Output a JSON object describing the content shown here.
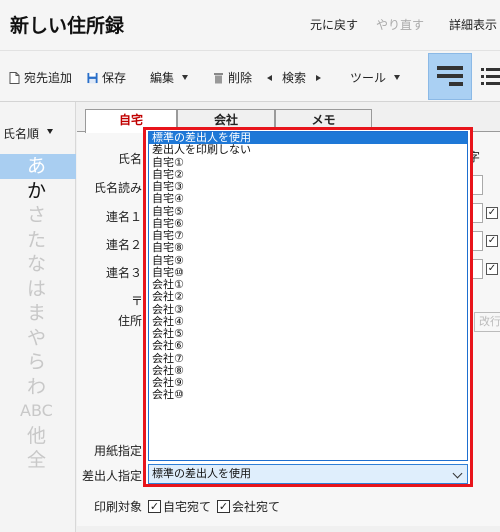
{
  "window": {
    "title": "新しい住所録",
    "undo_label": "元に戻す",
    "redo_label": "やり直す",
    "detail_view_label": "詳細表示"
  },
  "toolbar": {
    "add_label": "宛先追加",
    "save_label": "保存",
    "edit_label": "編集",
    "delete_label": "削除",
    "search_label": "検索",
    "tools_label": "ツール"
  },
  "index_panel": {
    "sort_label": "氏名順",
    "items": [
      "あ",
      "か",
      "さ",
      "た",
      "な",
      "は",
      "ま",
      "や",
      "ら",
      "わ",
      "ABC",
      "他",
      "全"
    ]
  },
  "tabs": [
    "自宅",
    "会社",
    "メモ"
  ],
  "form": {
    "labels": {
      "name": "氏名",
      "name_reading": "氏名読み",
      "joint1": "連名１",
      "joint2": "連名２",
      "joint3": "連名３",
      "postal": "〒",
      "address": "住所",
      "paper": "用紙指定",
      "sender": "差出人指定",
      "print_target": "印刷対象"
    },
    "edge_text": "字",
    "newline_button": "改行",
    "print_home": "自宅宛て",
    "print_company": "会社宛て"
  },
  "sender_dropdown": {
    "selected_value": "標準の差出人を使用",
    "options": [
      "標準の差出人を使用",
      "差出人を印刷しない",
      "自宅①",
      "自宅②",
      "自宅③",
      "自宅④",
      "自宅⑤",
      "自宅⑥",
      "自宅⑦",
      "自宅⑧",
      "自宅⑨",
      "自宅⑩",
      "会社①",
      "会社②",
      "会社③",
      "会社④",
      "会社⑤",
      "会社⑥",
      "会社⑦",
      "会社⑧",
      "会社⑨",
      "会社⑩"
    ]
  },
  "colors": {
    "accent": "#1e78d7",
    "highlight_border": "#e8141b",
    "active_tab_text": "#c00000",
    "index_active": "#a9cef1"
  }
}
